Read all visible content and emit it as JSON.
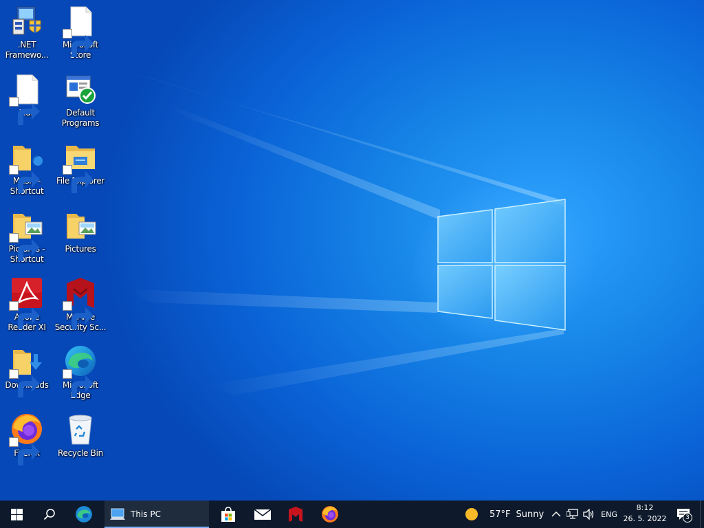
{
  "desktop_icons": [
    {
      "id": "dotnet",
      "label": ".NET Framewo...",
      "icon": "dotnet-installer-icon",
      "shortcut": false
    },
    {
      "id": "store",
      "label": "Microsoft Store",
      "icon": "blank-document-icon",
      "shortcut": true
    },
    {
      "id": "mail",
      "label": "Mail",
      "icon": "blank-document-icon",
      "shortcut": true
    },
    {
      "id": "default-programs",
      "label": "Default Programs",
      "icon": "default-programs-icon",
      "shortcut": false
    },
    {
      "id": "music",
      "label": "Music - Shortcut",
      "icon": "music-folder-icon",
      "shortcut": true
    },
    {
      "id": "file-explorer",
      "label": "File Explorer",
      "icon": "file-explorer-icon",
      "shortcut": true
    },
    {
      "id": "pictures-shortcut",
      "label": "Pictures - Shortcut",
      "icon": "pictures-folder-icon",
      "shortcut": true
    },
    {
      "id": "pictures",
      "label": "Pictures",
      "icon": "pictures-folder-icon",
      "shortcut": false
    },
    {
      "id": "adobe",
      "label": "Adobe Reader XI",
      "icon": "adobe-reader-icon",
      "shortcut": true
    },
    {
      "id": "mcafee",
      "label": "McAfee Security Sc...",
      "icon": "mcafee-icon",
      "shortcut": true
    },
    {
      "id": "downloads",
      "label": "Downloads",
      "icon": "downloads-folder-icon",
      "shortcut": true
    },
    {
      "id": "edge",
      "label": "Microsoft Edge",
      "icon": "edge-icon",
      "shortcut": true
    },
    {
      "id": "firefox",
      "label": "Firefox",
      "icon": "firefox-icon",
      "shortcut": true
    },
    {
      "id": "recycle",
      "label": "Recycle Bin",
      "icon": "recycle-bin-icon",
      "shortcut": false
    }
  ],
  "taskbar": {
    "start_icon": "windows-start-icon",
    "search_icon": "search-icon",
    "pinned": [
      {
        "id": "edge",
        "icon": "edge-icon"
      },
      {
        "id": "this-pc",
        "icon": "this-pc-icon",
        "label": "This PC",
        "active": true
      },
      {
        "id": "store",
        "icon": "store-bag-icon"
      },
      {
        "id": "mail",
        "icon": "mail-envelope-icon"
      },
      {
        "id": "mcafee",
        "icon": "mcafee-icon"
      },
      {
        "id": "firefox",
        "icon": "firefox-icon"
      }
    ],
    "weather": {
      "temp": "57°F",
      "condition": "Sunny",
      "icon": "sun-icon"
    },
    "tray": {
      "chevron_icon": "chevron-up-icon",
      "network_icon": "network-icon",
      "volume_icon": "volume-icon",
      "language": "ENG"
    },
    "clock": {
      "time": "8:12",
      "date": "26. 5. 2022"
    },
    "notifications": {
      "icon": "action-center-icon",
      "count": "3"
    }
  },
  "colors": {
    "taskbar_bg": "#0e1a2b",
    "desktop_accent": "#1786e8",
    "active_underline": "#7aaef0"
  }
}
